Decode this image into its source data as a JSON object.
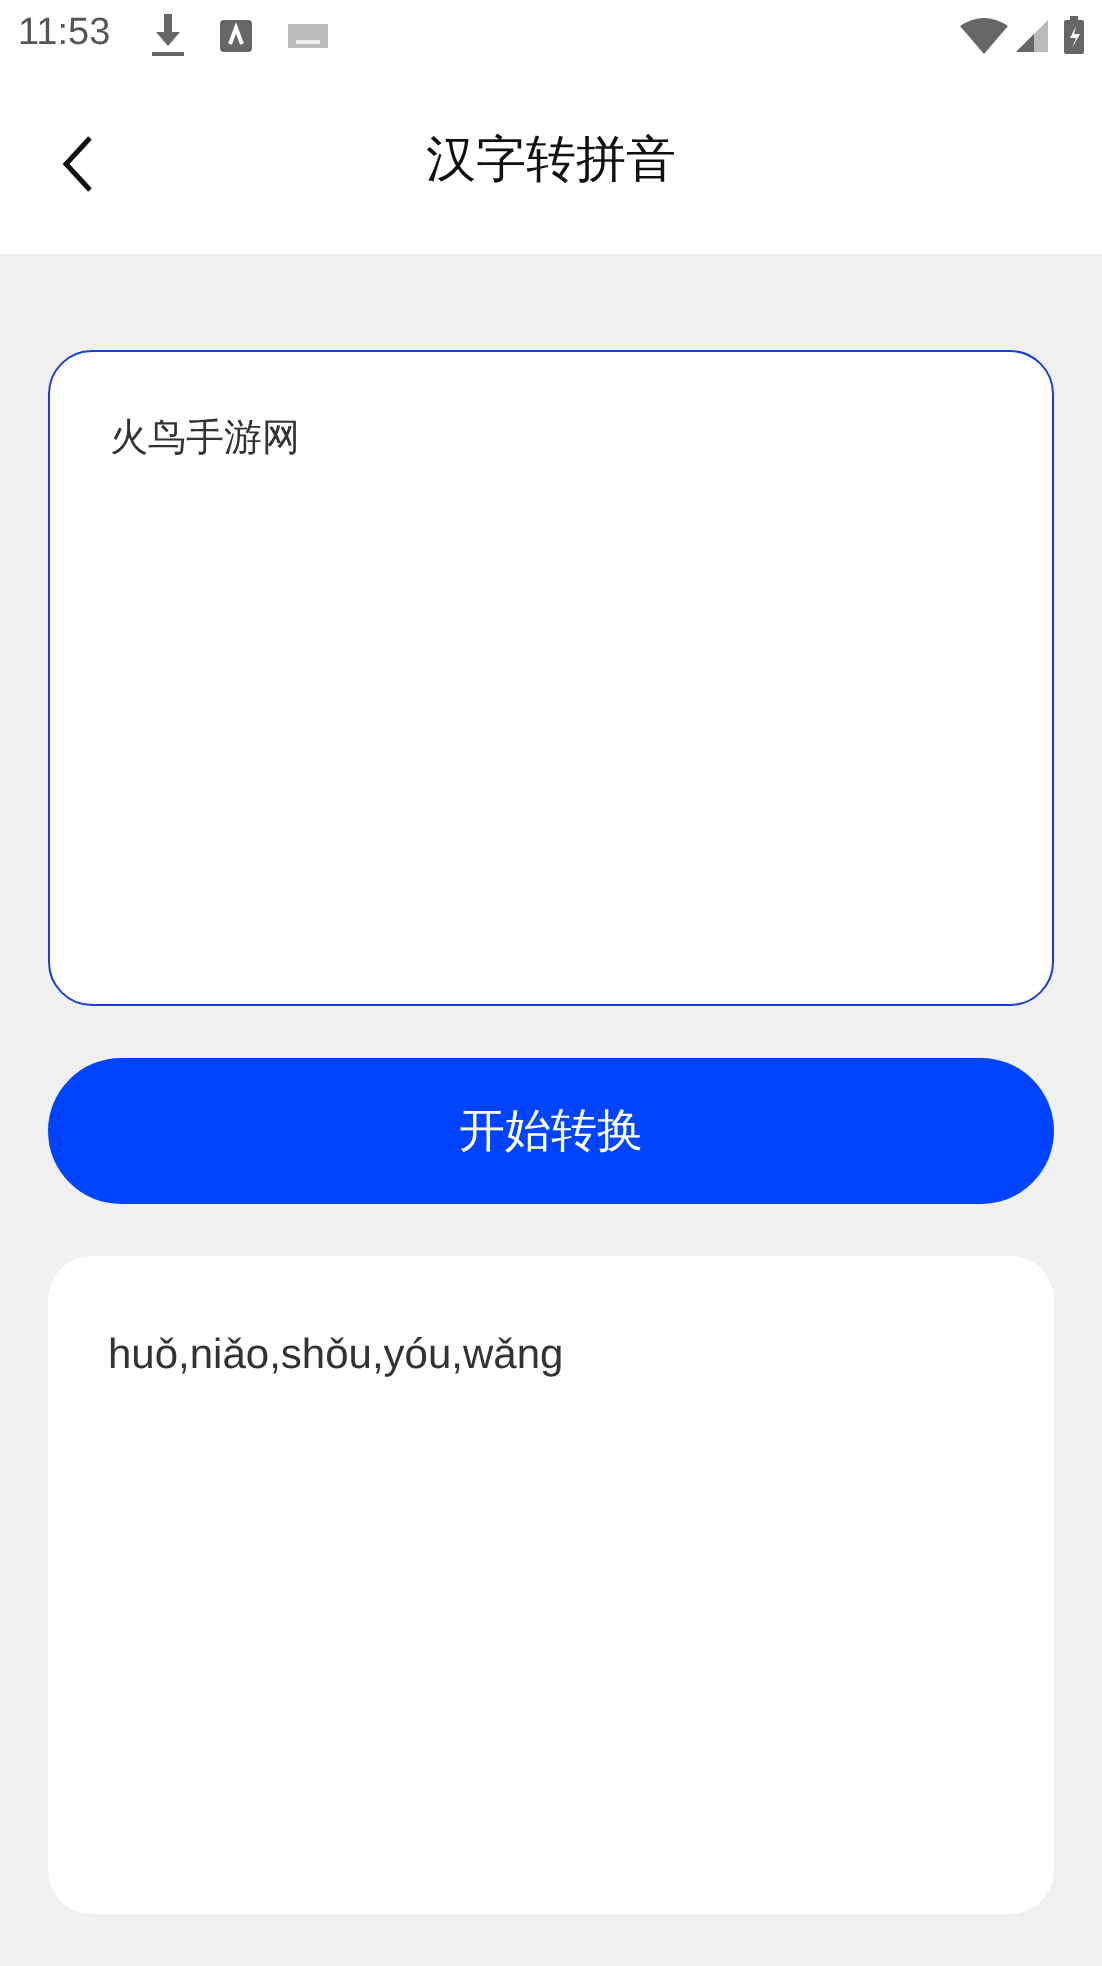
{
  "status_bar": {
    "time": "11:53"
  },
  "header": {
    "title": "汉字转拼音"
  },
  "input": {
    "value": "火鸟手游网"
  },
  "convert_button": {
    "label": "开始转换"
  },
  "output": {
    "text": "huǒ,niǎo,shǒu,yóu,wǎng"
  }
}
